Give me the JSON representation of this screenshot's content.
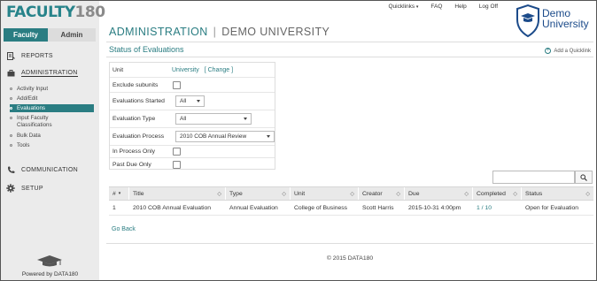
{
  "sidebar": {
    "logo_part1": "FACULTY",
    "logo_part2": "180",
    "role_tabs": [
      "Faculty",
      "Admin"
    ],
    "nav": [
      {
        "label": "REPORTS",
        "icon": "reports-icon"
      },
      {
        "label": "ADMINISTRATION",
        "icon": "briefcase-icon"
      },
      {
        "label": "COMMUNICATION",
        "icon": "phone-icon"
      },
      {
        "label": "SETUP",
        "icon": "gear-icon"
      }
    ],
    "sub_items": [
      "Activity Input",
      "Add/Edit",
      "Evaluations",
      "Input Faculty Classifications",
      "Bulk Data",
      "Tools"
    ],
    "powered_by": "Powered by DATA180"
  },
  "header": {
    "links": [
      "Quicklinks",
      "FAQ",
      "Help",
      "Log Off"
    ],
    "brand_line1": "Demo",
    "brand_line2": "University",
    "title": "ADMINISTRATION",
    "org": "DEMO UNIVERSITY",
    "section_title": "Status of Evaluations",
    "quicklink": "Add a Quicklink"
  },
  "filters": {
    "unit_label": "Unit",
    "unit_value": "University",
    "change_link": "[ Change ]",
    "exclude_label": "Exclude subunits",
    "started_label": "Evaluations Started",
    "started_value": "All",
    "type_label": "Evaluation Type",
    "type_value": "All",
    "process_label": "Evaluation Process",
    "process_value": "2010 COB Annual Review",
    "inprocess_label": "In Process Only",
    "pastdue_label": "Past Due Only"
  },
  "table": {
    "headers": [
      "#",
      "Title",
      "Type",
      "Unit",
      "Creator",
      "Due",
      "Completed",
      "Status"
    ],
    "rows": [
      [
        "1",
        "2010 COB Annual Evaluation",
        "Annual Evaluation",
        "College of Business",
        "Scott Harris",
        "2015-10-31 4:00pm",
        "1 / 10",
        "Open for Evaluation"
      ]
    ]
  },
  "go_back": "Go Back",
  "footer": "© 2015 DATA180",
  "colors": {
    "accent": "#2a7d82",
    "brand_blue": "#1c4b8a"
  }
}
